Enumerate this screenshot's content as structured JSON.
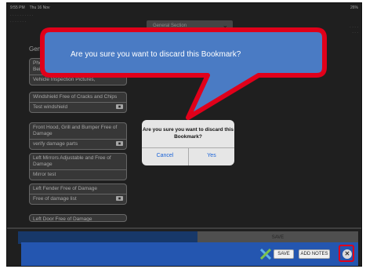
{
  "status_bar": {
    "time": "9:55 PM",
    "date": "Thu 16 Nov",
    "battery": "26%"
  },
  "header": {
    "dropdown_value": "General Section"
  },
  "section": {
    "label": "Gener"
  },
  "cards": [
    {
      "title": "Photo...\nBeing...",
      "subtitle": "Vehicle Inspection Pictures,",
      "has_camera": false
    },
    {
      "title": "Windshield Free of Cracks and Chips",
      "subtitle": "Test windshield",
      "has_camera": true
    },
    {
      "title": "Front Hood, Grill and Bumper Free of Damage",
      "subtitle": "verify damage parts",
      "has_camera": true
    },
    {
      "title": "Left Mirrors Adjustable and Free of Damage",
      "subtitle": "Mirror test",
      "has_camera": false
    },
    {
      "title": "Left Fender Free of Damage",
      "subtitle": "Free of damage list",
      "has_camera": true
    },
    {
      "title": "Left Door Free of Damage",
      "subtitle": "",
      "has_camera": false
    }
  ],
  "lower_bar": {
    "right_label": "SAVE"
  },
  "bottom_bar": {
    "save_label": "SAVE",
    "add_notes_label": "ADD NOTES",
    "close_glyph": "✕"
  },
  "alert": {
    "message": "Are you sure you want to discard this Bookmark?",
    "cancel_label": "Cancel",
    "yes_label": "Yes"
  },
  "callout": {
    "text": "Are you sure you want to discard this Bookmark?",
    "fill_color": "#4a7bc4",
    "border_color": "#e0001a"
  },
  "colors": {
    "accent_blue": "#2456b0",
    "highlight_red": "#e0001a",
    "alert_button": "#1a63d8"
  }
}
